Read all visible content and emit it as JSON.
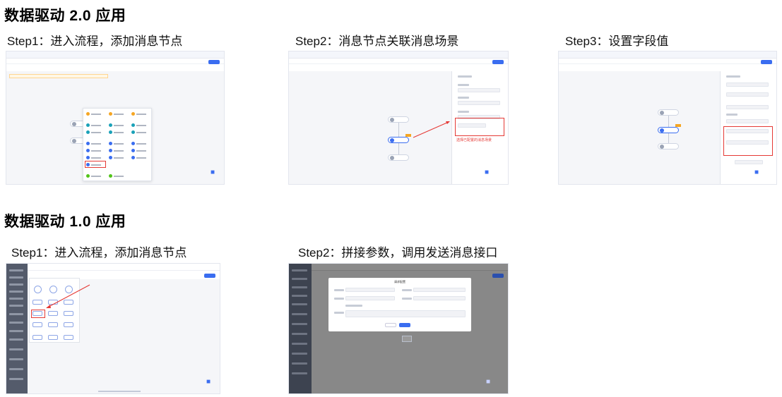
{
  "sections": [
    {
      "title": "数据驱动 2.0 应用",
      "steps": [
        {
          "label": "Step1：进入流程，添加消息节点"
        },
        {
          "label": "Step2：消息节点关联消息场景",
          "annotation": "选择已配置的消息场景"
        },
        {
          "label": "Step3：设置字段值"
        }
      ]
    },
    {
      "title": "数据驱动 1.0 应用",
      "steps": [
        {
          "label": "Step1：进入流程，添加消息节点"
        },
        {
          "label": "Step2：拼接参数，调用发送消息接口",
          "modal_title": "请求配置"
        }
      ]
    }
  ],
  "colors": {
    "accent": "#3a6df0",
    "highlight": "#e53935",
    "sidebar": "#545b6b",
    "canvas": "#f5f6f9"
  },
  "icons": {
    "assistant": "robot-icon",
    "arrow": "red-arrow"
  }
}
